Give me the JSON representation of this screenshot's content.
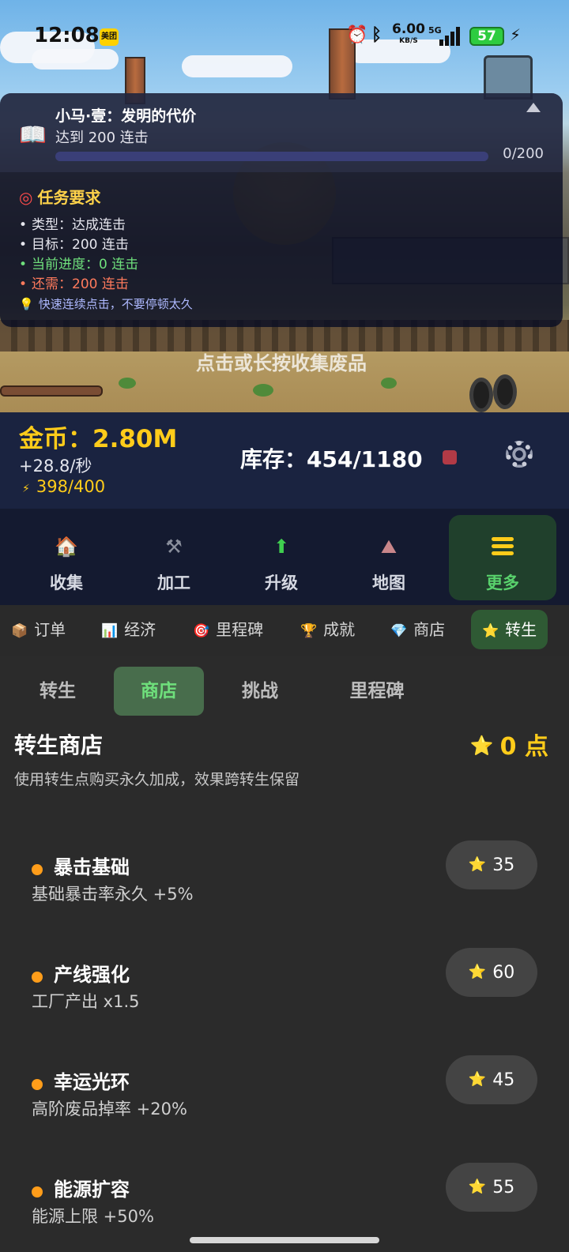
{
  "status_bar": {
    "time": "12:08",
    "app_badge": "美团",
    "net_speed": "6.00",
    "net_unit": "KB/S",
    "network": "5G",
    "battery": "57"
  },
  "quest": {
    "icon": "book-icon",
    "title": "小马·壹：发明的代价",
    "subtitle": "达到 200 连击",
    "progress_text": "0/200",
    "progress_fraction": 0,
    "requirements_title": "任务要求",
    "lines": [
      {
        "text": "类型：达成连击",
        "color": "#e6e6ee"
      },
      {
        "text": "目标：200 连击",
        "color": "#e6e6ee"
      },
      {
        "text": "当前进度：0 连击",
        "color": "#6fe07c"
      },
      {
        "text": "还需：200 连击",
        "color": "#ff7a5c"
      }
    ],
    "tip": "快速连续点击，不要停顿太久"
  },
  "scene": {
    "tap_hint": "点击或长按收集废品"
  },
  "resources": {
    "gold": "金币：2.80M",
    "rate": "+28.8/秒",
    "energy": "398/400",
    "storage": "库存：454/1180"
  },
  "main_nav": [
    {
      "label": "收集",
      "icon": "house-icon",
      "glyph": "🏠",
      "active": false
    },
    {
      "label": "加工",
      "icon": "hammer-icon",
      "glyph": "⚒",
      "active": false
    },
    {
      "label": "升级",
      "icon": "up-arrow-icon",
      "glyph": "⬆",
      "active": false
    },
    {
      "label": "地图",
      "icon": "map-icon",
      "glyph": "⛰",
      "active": false
    },
    {
      "label": "更多",
      "icon": "menu-icon",
      "glyph": "",
      "active": true
    }
  ],
  "sub_tabs": [
    {
      "label": "订单",
      "icon": "box-icon",
      "glyph": "📦"
    },
    {
      "label": "经济",
      "icon": "chart-icon",
      "glyph": "📊"
    },
    {
      "label": "里程碑",
      "icon": "target-icon",
      "glyph": "🎯"
    },
    {
      "label": "成就",
      "icon": "trophy-icon",
      "glyph": "🏆"
    },
    {
      "label": "商店",
      "icon": "gem-icon",
      "glyph": "💎"
    },
    {
      "label": "转生",
      "icon": "star-icon",
      "glyph": "⭐",
      "active": true
    }
  ],
  "segments": [
    {
      "label": "转生",
      "active": false
    },
    {
      "label": "商店",
      "active": true
    },
    {
      "label": "挑战",
      "active": false
    },
    {
      "label": "里程碑",
      "active": false
    }
  ],
  "shop": {
    "title": "转生商店",
    "points": "0 点",
    "description": "使用转生点购买永久加成，效果跨转生保留",
    "items": [
      {
        "name": "暴击基础",
        "desc": "基础暴击率永久 +5%",
        "cost": "35"
      },
      {
        "name": "产线强化",
        "desc": "工厂产出 x1.5",
        "cost": "60"
      },
      {
        "name": "幸运光环",
        "desc": "高阶废品掉率 +20%",
        "cost": "45"
      },
      {
        "name": "能源扩容",
        "desc": "能源上限 +50%",
        "cost": "55"
      }
    ]
  },
  "colors": {
    "accent_gold": "#ffcc1a",
    "accent_green": "#58d16c",
    "panel_dark": "#1a2340"
  }
}
